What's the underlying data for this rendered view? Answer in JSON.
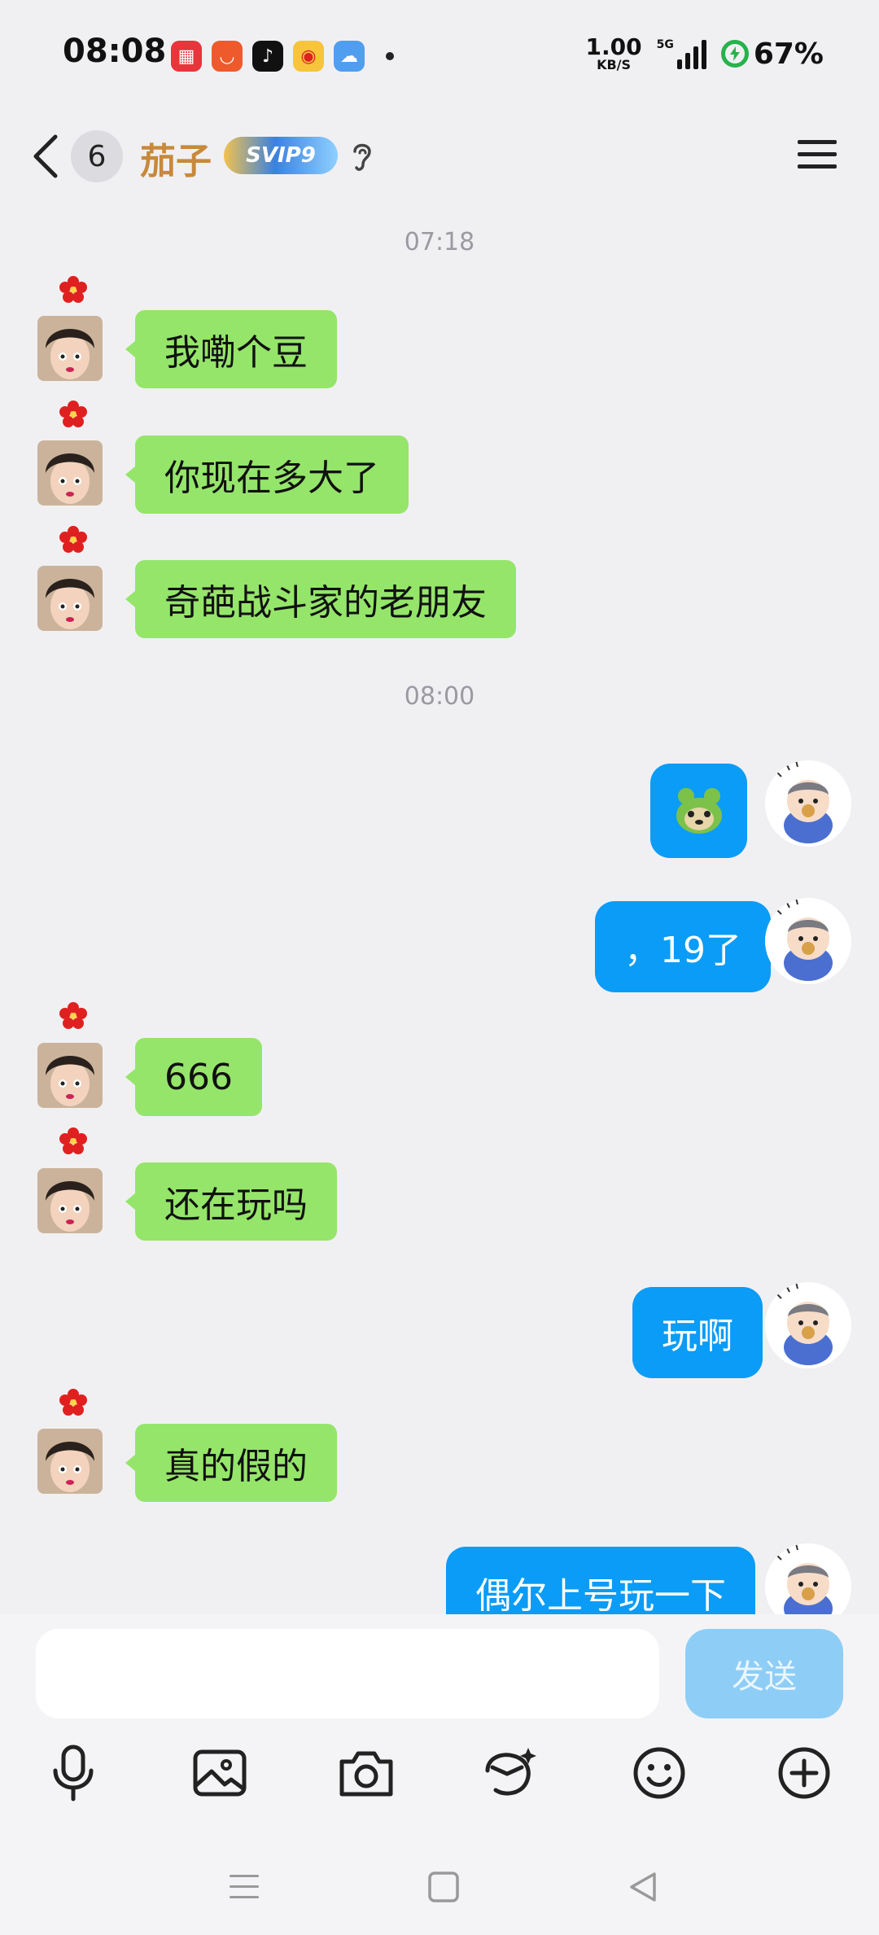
{
  "status_bar": {
    "time": "08:08",
    "net_speed_value": "1.00",
    "net_speed_unit": "KB/S",
    "network_tag": "5G",
    "battery": "67%"
  },
  "header": {
    "unread_count": "6",
    "contact_name": "茄子",
    "vip_badge_text": "SVIP9"
  },
  "messages": {
    "time_1": "07:18",
    "m1": "我嘞个豆",
    "m2": "你现在多大了",
    "m3": "奇葩战斗家的老朋友",
    "time_2": "08:00",
    "m5": "，19了",
    "m6": "666",
    "m7": "还在玩吗",
    "m8": "玩啊",
    "m9": "真的假的",
    "m10": "偶尔上号玩一下"
  },
  "input": {
    "value": "",
    "send_label": "发送"
  },
  "colors": {
    "incoming_bubble": "#95e56a",
    "outgoing_bubble": "#0a9cf6",
    "name": "#c8893a",
    "send_disabled": "#8ecdf6"
  }
}
